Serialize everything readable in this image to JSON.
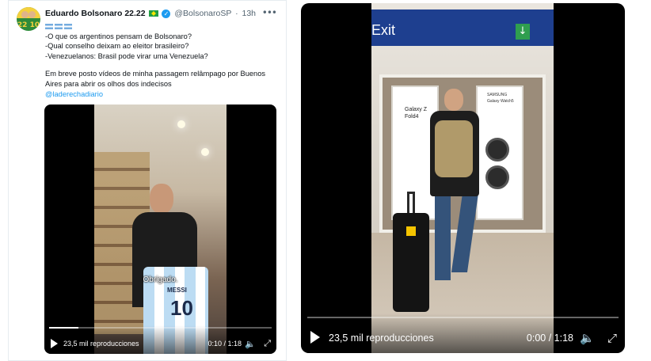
{
  "tweet": {
    "author_name": "Eduardo Bolsonaro 22.22",
    "handle": "@BolsonaroSP",
    "separator": "·",
    "time": "13h",
    "avatar_number": "22 10",
    "lines": [
      "-O que os argentinos pensam de Bolsonaro?",
      "-Qual conselho deixam ao eleitor brasileiro?",
      "-Venezuelanos: Brasil pode virar uma Venezuela?"
    ],
    "paragraph": "Em breve posto vídeos de minha passagem relâmpago por Buenos Aires para abrir os olhos dos indecisos",
    "mention": "@laderechadiario",
    "more_icon": "more-dots-icon",
    "verified_icon": "verified-badge-icon"
  },
  "video1": {
    "subtitle": "Obrigado.",
    "shirt_name": "MESSI",
    "shirt_number": "10",
    "views": "23,5 mil reproducciones",
    "time": "0:10 / 1:18",
    "progress": 0.13
  },
  "video2": {
    "sign_text": "Exit",
    "ad_left": "Galaxy Z Fold4",
    "ad_right": "SAMSUNG Galaxy Watch5",
    "views": "23,5 mil reproducciones",
    "time": "0:00 / 1:18",
    "progress": 0.0
  },
  "colors": {
    "link": "#1d9bf0",
    "text": "#0f1419",
    "muted": "#536471"
  }
}
